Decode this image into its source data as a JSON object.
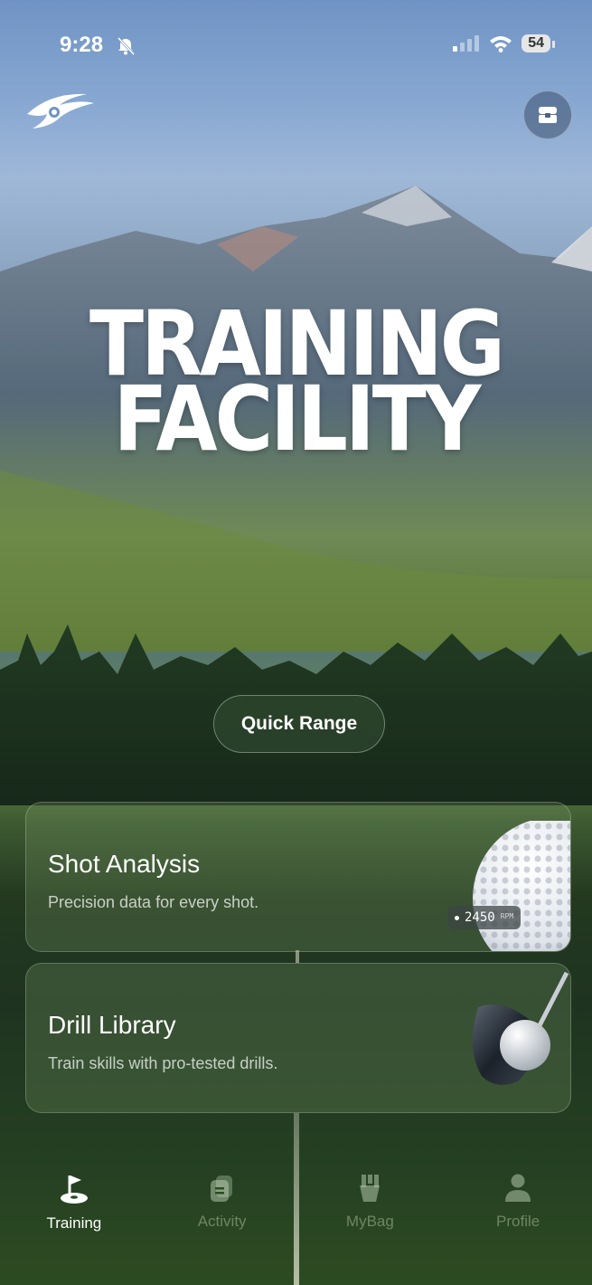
{
  "status": {
    "time": "9:28",
    "battery": "54"
  },
  "hero": {
    "title_line1": "TRAINING",
    "title_line2": "FACILITY"
  },
  "quick_range": {
    "label": "Quick Range"
  },
  "cards": [
    {
      "title": "Shot Analysis",
      "subtitle": "Precision data for every shot.",
      "rpm_value": "2450",
      "rpm_unit": "RPM"
    },
    {
      "title": "Drill Library",
      "subtitle": "Train skills with pro-tested drills."
    }
  ],
  "tabs": [
    {
      "label": "Training",
      "icon": "flag-icon",
      "active": true
    },
    {
      "label": "Activity",
      "icon": "activity-icon",
      "active": false
    },
    {
      "label": "MyBag",
      "icon": "golf-bag-icon",
      "active": false
    },
    {
      "label": "Profile",
      "icon": "profile-icon",
      "active": false
    }
  ]
}
